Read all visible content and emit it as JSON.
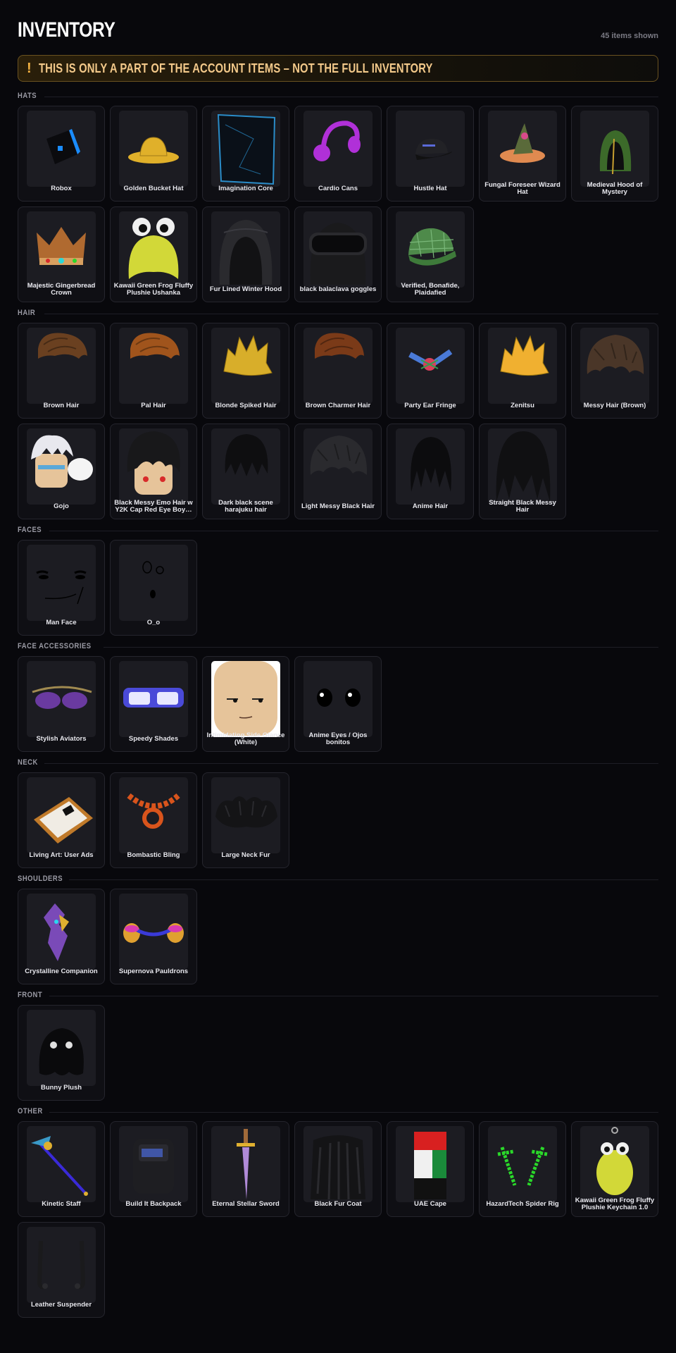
{
  "header": {
    "title": "INVENTORY",
    "items_shown": "45 items shown"
  },
  "banner": {
    "icon": "!",
    "text": "THIS IS ONLY A PART OF THE ACCOUNT ITEMS – NOT THE FULL INVENTORY",
    "accent_color": "#f5b342"
  },
  "sections": [
    {
      "label": "HATS",
      "items": [
        {
          "name": "Robox",
          "icon": "robox-cube-icon",
          "color": "#1a8cff"
        },
        {
          "name": "Golden Bucket Hat",
          "icon": "bucket-hat-icon",
          "color": "#e0b02a"
        },
        {
          "name": "Imagination Core",
          "icon": "glass-cube-icon",
          "color": "#2a8cc8"
        },
        {
          "name": "Cardio Cans",
          "icon": "headphones-icon",
          "color": "#b030d8"
        },
        {
          "name": "Hustle Hat",
          "icon": "cap-icon",
          "color": "#222226"
        },
        {
          "name": "Fungal Foreseer Wizard Hat",
          "icon": "wizard-hat-icon",
          "color": "#e08a50"
        },
        {
          "name": "Medieval Hood of Mystery",
          "icon": "hood-icon",
          "color": "#3c6a2a"
        },
        {
          "name": "Majestic Gingerbread Crown",
          "icon": "crown-icon",
          "color": "#b06a30"
        },
        {
          "name": "Kawaii Green Frog Fluffy Plushie Ushanka",
          "icon": "frog-hat-icon",
          "color": "#d2d838"
        },
        {
          "name": "Fur Lined Winter Hood",
          "icon": "winter-hood-icon",
          "color": "#2a2a2e"
        },
        {
          "name": "black balaclava goggles",
          "icon": "balaclava-icon",
          "color": "#1a1a1c"
        },
        {
          "name": "Verified, Bonafide, Plaidafied",
          "icon": "plaid-cap-icon",
          "color": "#4e8a4a"
        }
      ]
    },
    {
      "label": "HAIR",
      "items": [
        {
          "name": "Brown Hair",
          "icon": "hair-icon",
          "color": "#6a4020"
        },
        {
          "name": "Pal Hair",
          "icon": "hair-icon",
          "color": "#a0541c"
        },
        {
          "name": "Blonde Spiked Hair",
          "icon": "spiked-hair-icon",
          "color": "#d8ae2a"
        },
        {
          "name": "Brown Charmer Hair",
          "icon": "hair-icon",
          "color": "#7a3a18"
        },
        {
          "name": "Party Ear Fringe",
          "icon": "ear-fringe-icon",
          "color": "#d8405a"
        },
        {
          "name": "Zenitsu",
          "icon": "spiked-hair-icon",
          "color": "#f0b030"
        },
        {
          "name": "Messy Hair (Brown)",
          "icon": "messy-hair-icon",
          "color": "#4a3628"
        },
        {
          "name": "Gojo",
          "icon": "gojo-head-icon",
          "color": "#e8e8ee"
        },
        {
          "name": "Black Messy Emo Hair w Y2K Cap Red Eye Boy…",
          "icon": "emo-head-icon",
          "color": "#18181a"
        },
        {
          "name": "Dark black scene harajuku hair",
          "icon": "scene-hair-icon",
          "color": "#0e0e10"
        },
        {
          "name": "Light Messy Black Hair",
          "icon": "messy-hair-icon",
          "color": "#2a2a2e"
        },
        {
          "name": "Anime Hair",
          "icon": "anime-hair-icon",
          "color": "#0c0c0e"
        },
        {
          "name": "Straight Black Messy Hair",
          "icon": "straight-hair-icon",
          "color": "#101012"
        }
      ]
    },
    {
      "label": "FACES",
      "items": [
        {
          "name": "Man Face",
          "icon": "man-face-icon",
          "color": "#000000"
        },
        {
          "name": "O_o",
          "icon": "o-o-face-icon",
          "color": "#000000"
        }
      ]
    },
    {
      "label": "FACE ACCESSORIES",
      "items": [
        {
          "name": "Stylish Aviators",
          "icon": "aviators-icon",
          "color": "#6a3aa0"
        },
        {
          "name": "Speedy Shades",
          "icon": "shades-icon",
          "color": "#4a4ad8"
        },
        {
          "name": "Intimidating Side Glance (White)",
          "icon": "head-icon",
          "color": "#e6c49a"
        },
        {
          "name": "Anime Eyes / Ojos bonitos",
          "icon": "anime-eyes-icon",
          "color": "#000000"
        }
      ]
    },
    {
      "label": "NECK",
      "items": [
        {
          "name": "Living Art: User Ads",
          "icon": "picture-frame-icon",
          "color": "#c07a2a"
        },
        {
          "name": "Bombastic Bling",
          "icon": "chain-necklace-icon",
          "color": "#d8541c"
        },
        {
          "name": "Large Neck Fur",
          "icon": "neck-fur-icon",
          "color": "#141416"
        }
      ]
    },
    {
      "label": "SHOULDERS",
      "items": [
        {
          "name": "Crystalline Companion",
          "icon": "crystal-creature-icon",
          "color": "#7a4ab8"
        },
        {
          "name": "Supernova Pauldrons",
          "icon": "pauldrons-icon",
          "color": "#e0a030"
        }
      ]
    },
    {
      "label": "FRONT",
      "items": [
        {
          "name": "Bunny Plush",
          "icon": "bunny-plush-icon",
          "color": "#0a0a0c"
        }
      ]
    },
    {
      "label": "OTHER",
      "items": [
        {
          "name": "Kinetic Staff",
          "icon": "staff-icon",
          "color": "#3a9ac8"
        },
        {
          "name": "Build It Backpack",
          "icon": "backpack-icon",
          "color": "#1e1e22"
        },
        {
          "name": "Eternal Stellar Sword",
          "icon": "sword-icon",
          "color": "#b08ad8"
        },
        {
          "name": "Black Fur Coat",
          "icon": "fur-coat-icon",
          "color": "#141416"
        },
        {
          "name": "UAE Cape",
          "icon": "cape-icon",
          "color": "#d82020"
        },
        {
          "name": "HazardTech Spider Rig",
          "icon": "spider-rig-icon",
          "color": "#2ad82a"
        },
        {
          "name": "Kawaii Green Frog Fluffy Plushie Keychain 1.0",
          "icon": "frog-keychain-icon",
          "color": "#d2d838"
        },
        {
          "name": "Leather Suspender",
          "icon": "suspender-icon",
          "color": "#1a1a1c"
        }
      ]
    }
  ]
}
